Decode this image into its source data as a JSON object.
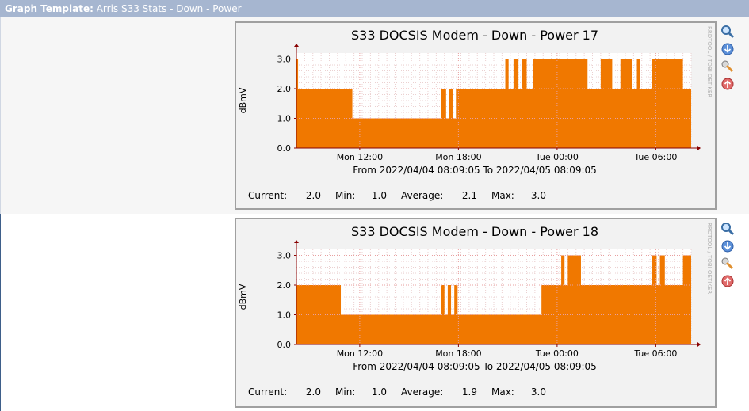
{
  "header": {
    "label": "Graph Template:",
    "value": "Arris S33 Stats - Down - Power"
  },
  "graphs": [
    {
      "title": "S33 DOCSIS Modem - Down - Power 17",
      "ylabel": "dBmV",
      "watermark": "RRDTOOL / TOBI OETIKER",
      "range_text": "From 2022/04/04 08:09:05 To 2022/04/05 08:09:05",
      "stats": {
        "current_label": "Current:",
        "current": "2.0",
        "min_label": "Min:",
        "min": "1.0",
        "avg_label": "Average:",
        "avg": "2.1",
        "max_label": "Max:",
        "max": "3.0"
      }
    },
    {
      "title": "S33 DOCSIS Modem - Down - Power 18",
      "ylabel": "dBmV",
      "watermark": "RRDTOOL / TOBI OETIKER",
      "range_text": "From 2022/04/04 08:09:05 To 2022/04/05 08:09:05",
      "stats": {
        "current_label": "Current:",
        "current": "2.0",
        "min_label": "Min:",
        "min": "1.0",
        "avg_label": "Average:",
        "avg": "1.9",
        "max_label": "Max:",
        "max": "3.0"
      }
    }
  ],
  "icons": [
    "zoom-icon",
    "download-icon",
    "properties-icon",
    "move-up-icon"
  ],
  "colors": {
    "area": "#f07800",
    "grid": "#e8a0a0",
    "axis": "#880000",
    "header": "#a6b6d0"
  },
  "chart_data": [
    {
      "type": "area",
      "title": "S33 DOCSIS Modem - Down - Power 17",
      "xlabel": "",
      "ylabel": "dBmV",
      "ylim": [
        0,
        3.2
      ],
      "x_ticks": [
        "Mon 12:00",
        "Mon 18:00",
        "Tue 00:00",
        "Tue 06:00"
      ],
      "y_ticks": [
        "0.0",
        "1.0",
        "2.0",
        "3.0"
      ],
      "grid": true,
      "x_hours_range": [
        0,
        24
      ],
      "x_hours": [
        0,
        0.1,
        0.1,
        3.4,
        3.4,
        8.8,
        8.8,
        9.1,
        9.1,
        9.3,
        9.3,
        9.5,
        9.5,
        9.7,
        9.7,
        9.9,
        9.9,
        12.7,
        12.7,
        12.9,
        12.9,
        13.2,
        13.2,
        13.5,
        13.5,
        13.7,
        13.7,
        14.0,
        14.0,
        14.4,
        14.4,
        14.9,
        14.9,
        17.7,
        17.7,
        18.5,
        18.5,
        19.2,
        19.2,
        19.7,
        19.7,
        20.4,
        20.4,
        20.7,
        20.7,
        20.9,
        20.9,
        21.6,
        21.6,
        23.5,
        23.5,
        23.9,
        23.9,
        24
      ],
      "values": [
        3.0,
        3.0,
        2.0,
        2.0,
        1.0,
        1.0,
        2.0,
        2.0,
        1.0,
        1.0,
        2.0,
        2.0,
        1.0,
        1.0,
        2.0,
        2.0,
        2.0,
        2.0,
        3.0,
        3.0,
        2.0,
        2.0,
        3.0,
        3.0,
        2.0,
        2.0,
        3.0,
        3.0,
        2.0,
        2.0,
        3.0,
        3.0,
        3.0,
        3.0,
        2.0,
        2.0,
        3.0,
        3.0,
        2.0,
        2.0,
        3.0,
        3.0,
        2.0,
        2.0,
        3.0,
        3.0,
        2.0,
        2.0,
        3.0,
        3.0,
        2.0,
        2.0,
        2.0,
        2.0
      ]
    },
    {
      "type": "area",
      "title": "S33 DOCSIS Modem - Down - Power 18",
      "xlabel": "",
      "ylabel": "dBmV",
      "ylim": [
        0,
        3.2
      ],
      "x_ticks": [
        "Mon 12:00",
        "Mon 18:00",
        "Tue 00:00",
        "Tue 06:00"
      ],
      "y_ticks": [
        "0.0",
        "1.0",
        "2.0",
        "3.0"
      ],
      "grid": true,
      "x_hours_range": [
        0,
        24
      ],
      "x_hours": [
        0,
        2.7,
        2.7,
        8.8,
        8.8,
        9.0,
        9.0,
        9.2,
        9.2,
        9.4,
        9.4,
        9.6,
        9.6,
        9.8,
        9.8,
        14.9,
        14.9,
        16.1,
        16.1,
        16.3,
        16.3,
        16.5,
        16.5,
        17.3,
        17.3,
        21.6,
        21.6,
        21.9,
        21.9,
        22.1,
        22.1,
        22.4,
        22.4,
        23.5,
        23.5,
        24
      ],
      "values": [
        2.0,
        2.0,
        1.0,
        1.0,
        2.0,
        2.0,
        1.0,
        1.0,
        2.0,
        2.0,
        1.0,
        1.0,
        2.0,
        2.0,
        1.0,
        1.0,
        2.0,
        2.0,
        3.0,
        3.0,
        2.0,
        2.0,
        3.0,
        3.0,
        2.0,
        2.0,
        3.0,
        3.0,
        2.0,
        2.0,
        3.0,
        3.0,
        2.0,
        2.0,
        3.0,
        3.0,
        2.0,
        2.0
      ]
    }
  ]
}
